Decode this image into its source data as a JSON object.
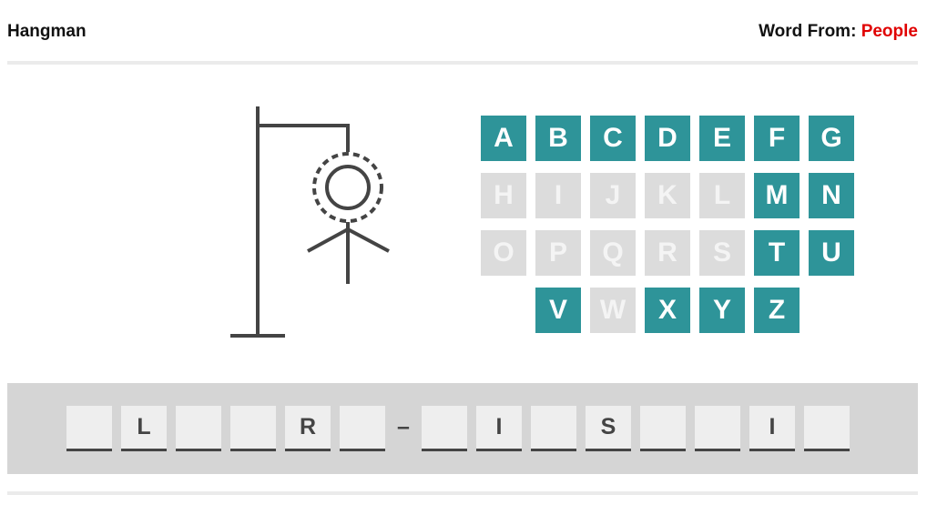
{
  "header": {
    "title": "Hangman",
    "source_label": "Word From:",
    "source_value": "People"
  },
  "colors": {
    "key_available": "#2e9499",
    "key_used": "#dcdcdc",
    "source_value": "#e00000",
    "drawing": "#444444",
    "word_bar": "#d5d5d5"
  },
  "drawing": {
    "parts_shown": [
      "base",
      "pole",
      "beam",
      "rope",
      "head",
      "body",
      "arms"
    ],
    "head_highlighted": true
  },
  "keyboard": {
    "keys": [
      {
        "letter": "A",
        "used": false
      },
      {
        "letter": "B",
        "used": false
      },
      {
        "letter": "C",
        "used": false
      },
      {
        "letter": "D",
        "used": false
      },
      {
        "letter": "E",
        "used": false
      },
      {
        "letter": "F",
        "used": false
      },
      {
        "letter": "G",
        "used": false
      },
      {
        "letter": "H",
        "used": true
      },
      {
        "letter": "I",
        "used": true
      },
      {
        "letter": "J",
        "used": true
      },
      {
        "letter": "K",
        "used": true
      },
      {
        "letter": "L",
        "used": true
      },
      {
        "letter": "M",
        "used": false
      },
      {
        "letter": "N",
        "used": false
      },
      {
        "letter": "O",
        "used": true
      },
      {
        "letter": "P",
        "used": true
      },
      {
        "letter": "Q",
        "used": true
      },
      {
        "letter": "R",
        "used": true
      },
      {
        "letter": "S",
        "used": true
      },
      {
        "letter": "T",
        "used": false
      },
      {
        "letter": "U",
        "used": false
      },
      {
        "letter": "V",
        "used": false
      },
      {
        "letter": "W",
        "used": true
      },
      {
        "letter": "X",
        "used": false
      },
      {
        "letter": "Y",
        "used": false
      },
      {
        "letter": "Z",
        "used": false
      }
    ]
  },
  "word": {
    "slots": [
      "",
      "L",
      "",
      "",
      "R",
      "",
      "–",
      "",
      "I",
      "",
      "S",
      "",
      "",
      "I",
      ""
    ]
  }
}
